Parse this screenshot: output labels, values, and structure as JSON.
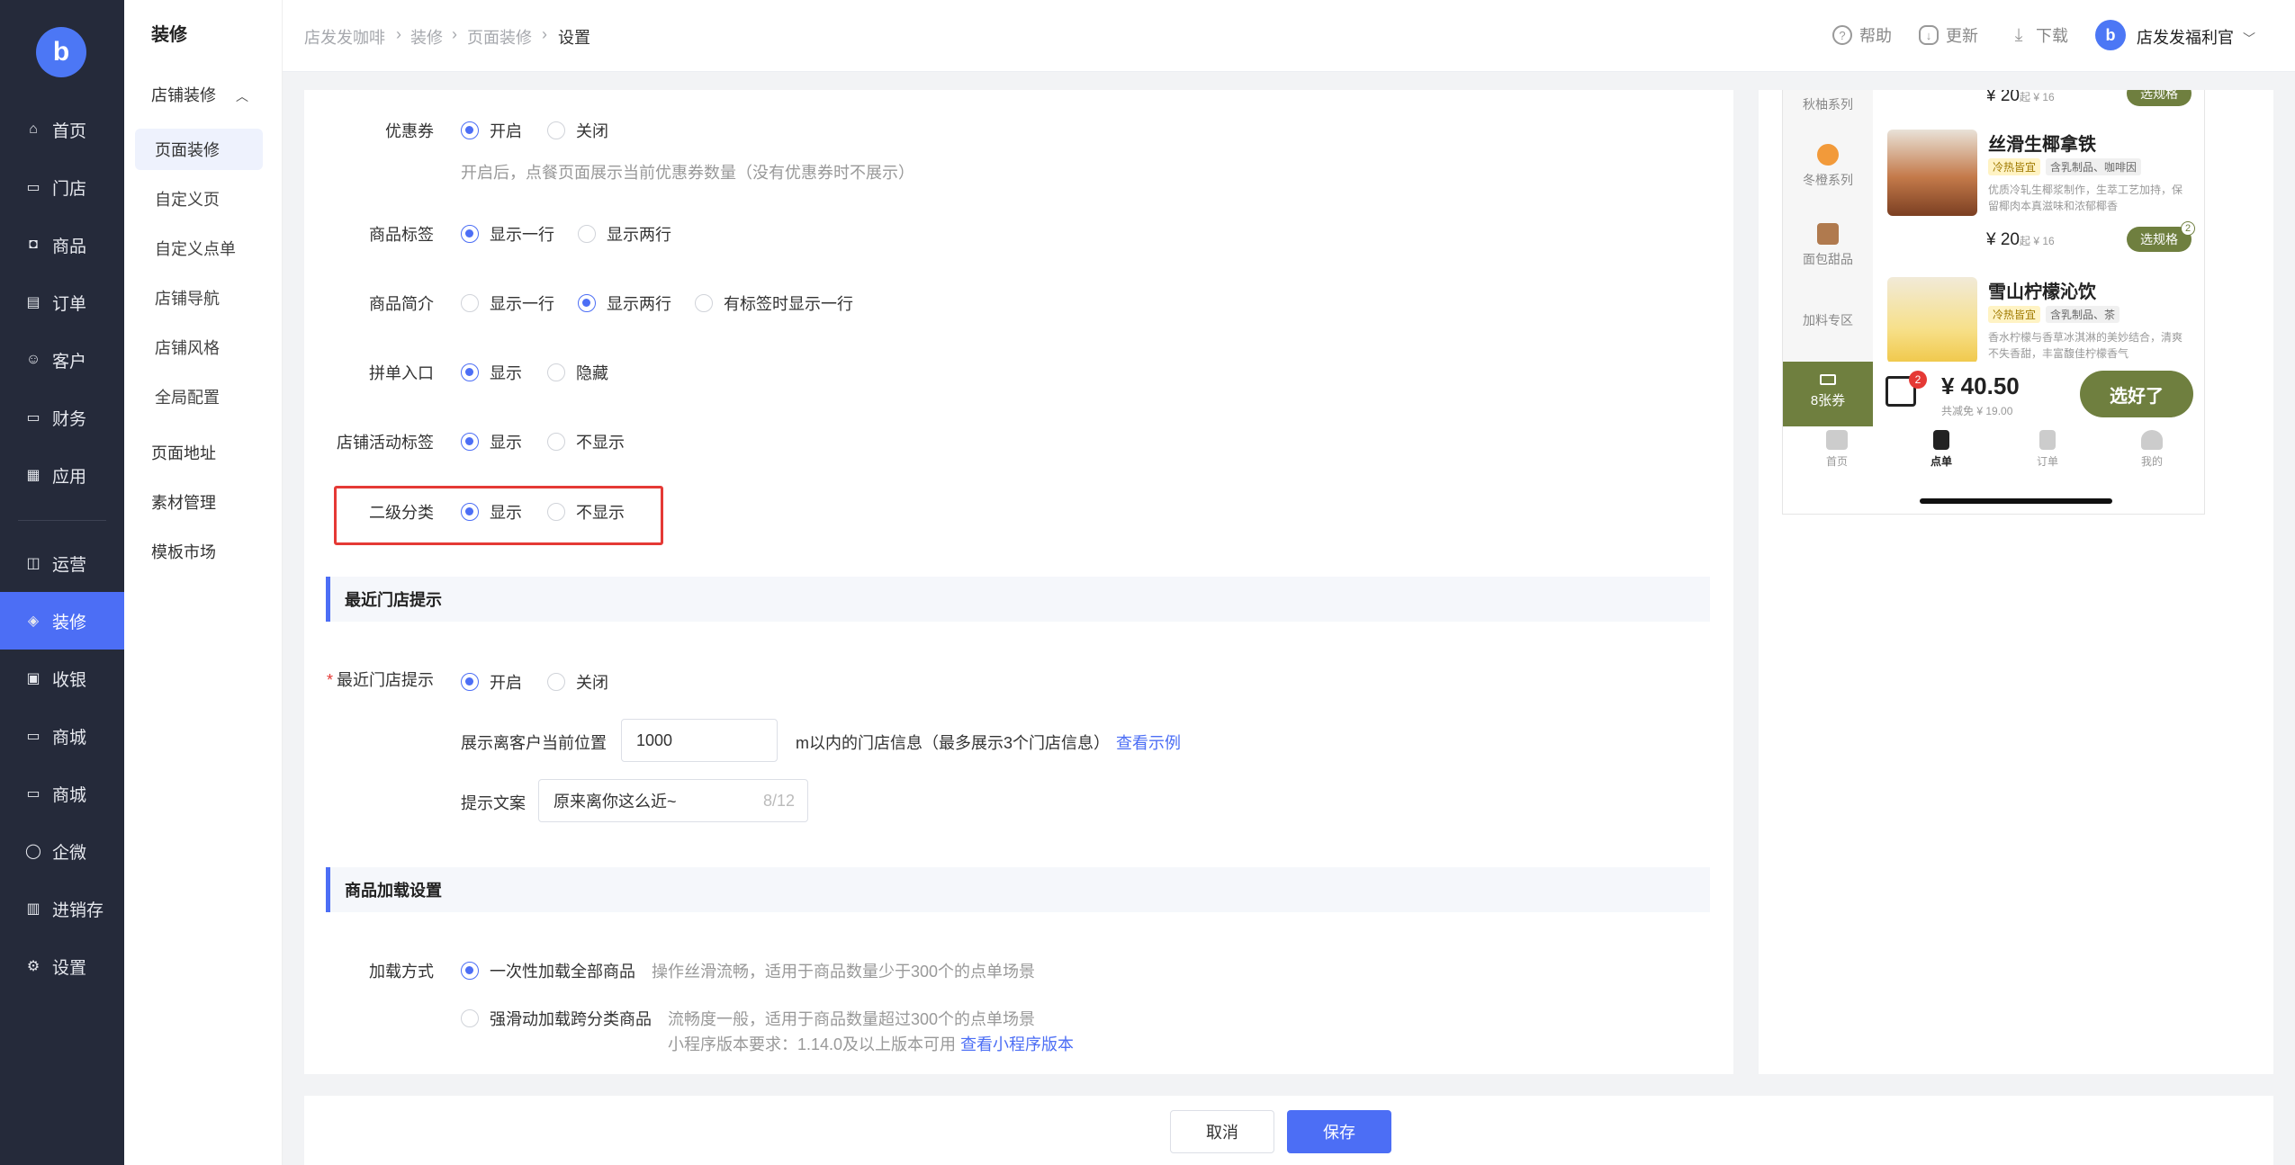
{
  "nav": {
    "logo": "b",
    "items": [
      {
        "label": "首页",
        "icon": "home-icon"
      },
      {
        "label": "门店",
        "icon": "store-icon"
      },
      {
        "label": "商品",
        "icon": "bag-icon"
      },
      {
        "label": "订单",
        "icon": "order-icon"
      },
      {
        "label": "客户",
        "icon": "user-icon"
      },
      {
        "label": "财务",
        "icon": "card-icon"
      },
      {
        "label": "应用",
        "icon": "grid-icon"
      },
      {
        "label": "运营",
        "icon": "gift-icon"
      },
      {
        "label": "装修",
        "icon": "layers-icon"
      },
      {
        "label": "收银",
        "icon": "cashier-icon"
      },
      {
        "label": "商城",
        "icon": "shop-icon"
      },
      {
        "label": "商城",
        "icon": "shop-icon"
      },
      {
        "label": "企微",
        "icon": "chat-icon"
      },
      {
        "label": "进销存",
        "icon": "inventory-icon"
      },
      {
        "label": "设置",
        "icon": "gear-icon"
      }
    ],
    "active_index": 8
  },
  "subnav": {
    "title": "装修",
    "group": "店铺装修",
    "items": [
      "页面装修",
      "自定义页",
      "自定义点单",
      "店铺导航",
      "店铺风格",
      "全局配置"
    ],
    "active_index": 0,
    "extra": [
      "页面地址",
      "素材管理",
      "模板市场"
    ]
  },
  "header": {
    "breadcrumb": [
      "店发发咖啡",
      "装修",
      "页面装修",
      "设置"
    ],
    "help": "帮助",
    "update": "更新",
    "download": "下载",
    "avatar": "b",
    "username": "店发发福利官"
  },
  "form": {
    "coupon": {
      "label": "优惠券",
      "options": [
        "开启",
        "关闭"
      ],
      "selected": 0,
      "hint": "开启后，点餐页面展示当前优惠券数量（没有优惠券时不展示）"
    },
    "product_tag": {
      "label": "商品标签",
      "options": [
        "显示一行",
        "显示两行"
      ],
      "selected": 0
    },
    "product_intro": {
      "label": "商品简介",
      "options": [
        "显示一行",
        "显示两行",
        "有标签时显示一行"
      ],
      "selected": 1
    },
    "group_buy": {
      "label": "拼单入口",
      "options": [
        "显示",
        "隐藏"
      ],
      "selected": 0
    },
    "activity_tag": {
      "label": "店铺活动标签",
      "options": [
        "显示",
        "不显示"
      ],
      "selected": 0
    },
    "sub_category": {
      "label": "二级分类",
      "options": [
        "显示",
        "不显示"
      ],
      "selected": 0
    },
    "section_nearby": "最近门店提示",
    "nearby": {
      "label": "最近门店提示",
      "required": "*",
      "options": [
        "开启",
        "关闭"
      ],
      "selected": 0
    },
    "distance": {
      "label": "展示离客户当前位置",
      "value": "1000",
      "suffix": "m以内的门店信息（最多展示3个门店信息）",
      "link": "查看示例"
    },
    "tip_text": {
      "label": "提示文案",
      "value": "原来离你这么近~",
      "count": "8/12"
    },
    "section_loading": "商品加载设置",
    "loading": {
      "label": "加载方式",
      "opt1": "一次性加载全部商品",
      "opt1_hint": "操作丝滑流畅，适用于商品数量少于300个的点单场景",
      "opt2": "强滑动加载跨分类商品",
      "opt2_hint": "流畅度一般，适用于商品数量超过300个的点单场景",
      "version_hint": "小程序版本要求：1.14.0及以上版本可用",
      "version_link": "查看小程序版本",
      "selected": 0
    }
  },
  "preview": {
    "categories": [
      "秋柚系列",
      "冬橙系列",
      "面包甜品",
      "加料专区"
    ],
    "top_price": "¥ 20",
    "top_price_small": "起 ¥ 16",
    "products": [
      {
        "name": "丝滑生椰拿铁",
        "tag1": "冷热皆宜",
        "tag2": "含乳制品、咖啡因",
        "desc": "优质冷轧生椰浆制作，生萃工艺加持，保留椰肉本真滋味和浓郁椰香",
        "price": "¥ 20",
        "price_small": "起 ¥ 16",
        "button": "选规格",
        "count": "2"
      },
      {
        "name": "雪山柠檬沁饮",
        "tag1": "冷热皆宜",
        "tag2": "含乳制品、茶",
        "desc": "香水柠檬与香草冰淇淋的美妙结合，清爽不失香甜，丰富馥佳柠檬香气"
      }
    ],
    "top_button": "选规格",
    "coupon_label": "8张券",
    "cart_badge": "2",
    "total": "¥ 40.50",
    "subtotal": "共减免 ¥ 19.00",
    "confirm": "选好了",
    "tabs": [
      "首页",
      "点单",
      "订单",
      "我的"
    ]
  },
  "footer": {
    "cancel": "取消",
    "save": "保存"
  },
  "colors": {
    "accent": "#4c6ef5",
    "nav_bg": "#252a3a",
    "brand_green": "#6f7f3f",
    "highlight_red": "#e53935"
  }
}
